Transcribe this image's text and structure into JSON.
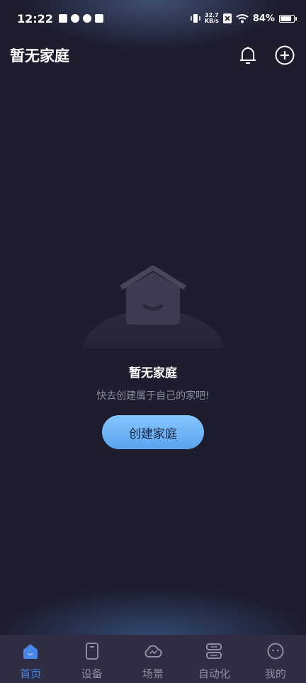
{
  "status_bar": {
    "time": "12:22",
    "net_speed_value": "32.7",
    "net_speed_unit": "KB/s",
    "battery": "84%"
  },
  "header": {
    "title": "暂无家庭"
  },
  "empty_state": {
    "title": "暂无家庭",
    "subtitle": "快去创建属于自己的家吧!",
    "button_label": "创建家庭"
  },
  "bottom_nav": {
    "items": [
      {
        "label": "首页",
        "icon": "home-icon",
        "active": true
      },
      {
        "label": "设备",
        "icon": "device-icon",
        "active": false
      },
      {
        "label": "场景",
        "icon": "scene-icon",
        "active": false
      },
      {
        "label": "自动化",
        "icon": "automation-icon",
        "active": false
      },
      {
        "label": "我的",
        "icon": "profile-icon",
        "active": false
      }
    ]
  },
  "colors": {
    "background": "#1d1d2e",
    "nav_background": "#2e2d42",
    "accent": "#4a86e8",
    "button_gradient_top": "#86c6ff",
    "button_gradient_bottom": "#5aa4ee"
  }
}
